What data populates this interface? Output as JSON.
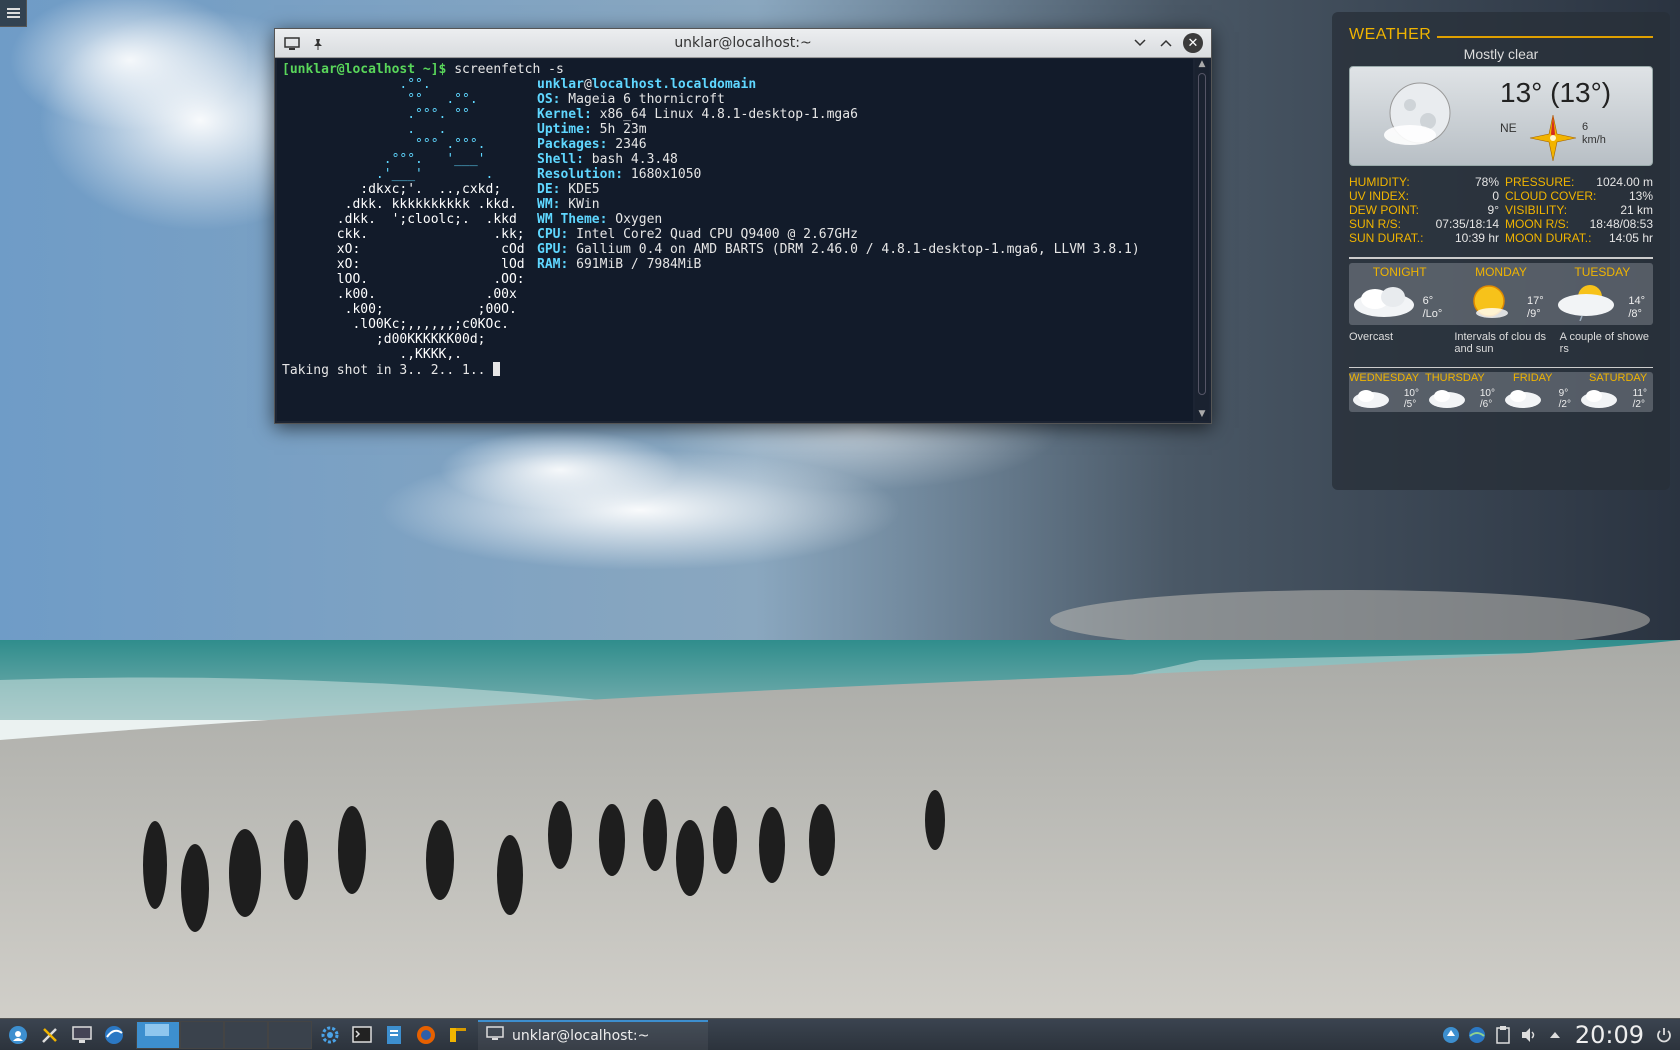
{
  "terminal": {
    "title": "unklar@localhost:~",
    "prompt": "[unklar@localhost ~]$",
    "command": " screenfetch -s",
    "user": "unklar",
    "at": "@",
    "host": "localhost.localdomain",
    "info": [
      {
        "label": "OS:",
        "value": " Mageia 6 thornicroft"
      },
      {
        "label": "Kernel:",
        "value": " x86_64 Linux 4.8.1-desktop-1.mga6"
      },
      {
        "label": "Uptime:",
        "value": " 5h 23m"
      },
      {
        "label": "Packages:",
        "value": " 2346"
      },
      {
        "label": "Shell:",
        "value": " bash 4.3.48"
      },
      {
        "label": "Resolution:",
        "value": " 1680x1050"
      },
      {
        "label": "DE:",
        "value": " KDE5"
      },
      {
        "label": "WM:",
        "value": " KWin"
      },
      {
        "label": "WM Theme:",
        "value": " Oxygen"
      },
      {
        "label": "CPU:",
        "value": " Intel Core2 Quad CPU Q9400 @ 2.67GHz"
      },
      {
        "label": "GPU:",
        "value": " Gallium 0.4 on AMD BARTS (DRM 2.46.0 / 4.8.1-desktop-1.mga6, LLVM 3.8.1)"
      },
      {
        "label": "RAM:",
        "value": " 691MiB / 7984MiB"
      }
    ],
    "logo": [
      "               .°°.",
      "                °°   .°°.",
      "                .°°°. °°",
      "                .   .",
      "                 °°° .°°°.",
      "             .°°°.   '___'",
      "            .'___'        .",
      "          :dkxc;'.  ..,cxkd;",
      "        .dkk. kkkkkkkkkk .kkd.",
      "       .dkk.  ';cloolc;.  .kkd",
      "       ckk.                .kk;",
      "       xO:                  cOd",
      "       xO:                  lOd",
      "       lOO.                .OO:",
      "       .k00.              .00x",
      "        .k00;            ;00O.",
      "         .lO0Kc;,,,,,,;c0KOc.",
      "            ;d00KKKKKK00d;",
      "               .,KKKK,."
    ],
    "footer": "Taking shot in 3.. 2.. 1.. "
  },
  "weather": {
    "title": "WEATHER",
    "condition": "Mostly clear",
    "temp": "13° (13°)",
    "wind_dir": "NE",
    "wind_speed": "6",
    "wind_unit": "km/h",
    "details_left": [
      {
        "label": "HUMIDITY:",
        "value": "78%"
      },
      {
        "label": "UV INDEX:",
        "value": "0"
      },
      {
        "label": "DEW POINT:",
        "value": "9°"
      },
      {
        "label": "SUN R/S:",
        "value": "07:35/18:14"
      },
      {
        "label": "SUN DURAT.:",
        "value": "10:39 hr"
      }
    ],
    "details_right": [
      {
        "label": "PRESSURE:",
        "value": "1024.00 m"
      },
      {
        "label": "CLOUD COVER:",
        "value": "13%"
      },
      {
        "label": "VISIBILITY:",
        "value": "21 km"
      },
      {
        "label": "MOON R/S:",
        "value": "18:48/08:53"
      },
      {
        "label": "MOON DURAT.:",
        "value": "14:05 hr"
      }
    ],
    "days": [
      {
        "name": "TONIGHT",
        "hi": "6°",
        "lo": "/Lo°",
        "desc": "Overcast"
      },
      {
        "name": "MONDAY",
        "hi": "17°",
        "lo": "/9°",
        "desc": "Intervals of clou ds and sun"
      },
      {
        "name": "TUESDAY",
        "hi": "14°",
        "lo": "/8°",
        "desc": "A couple of showe rs"
      }
    ],
    "week": [
      {
        "name": "WEDNESDAY",
        "hi": "10°",
        "lo": "/5°"
      },
      {
        "name": "THURSDAY",
        "hi": "10°",
        "lo": "/6°"
      },
      {
        "name": "FRIDAY",
        "hi": "9°",
        "lo": "/2°"
      },
      {
        "name": "SATURDAY",
        "hi": "11°",
        "lo": "/2°"
      }
    ]
  },
  "taskbar": {
    "task_label": "unklar@localhost:~",
    "clock": "20:09"
  },
  "colors": {
    "accent": "#3d8fcf",
    "weather_label": "#f0b400",
    "prompt": "#59d65a",
    "info_label": "#5fd7ff"
  }
}
